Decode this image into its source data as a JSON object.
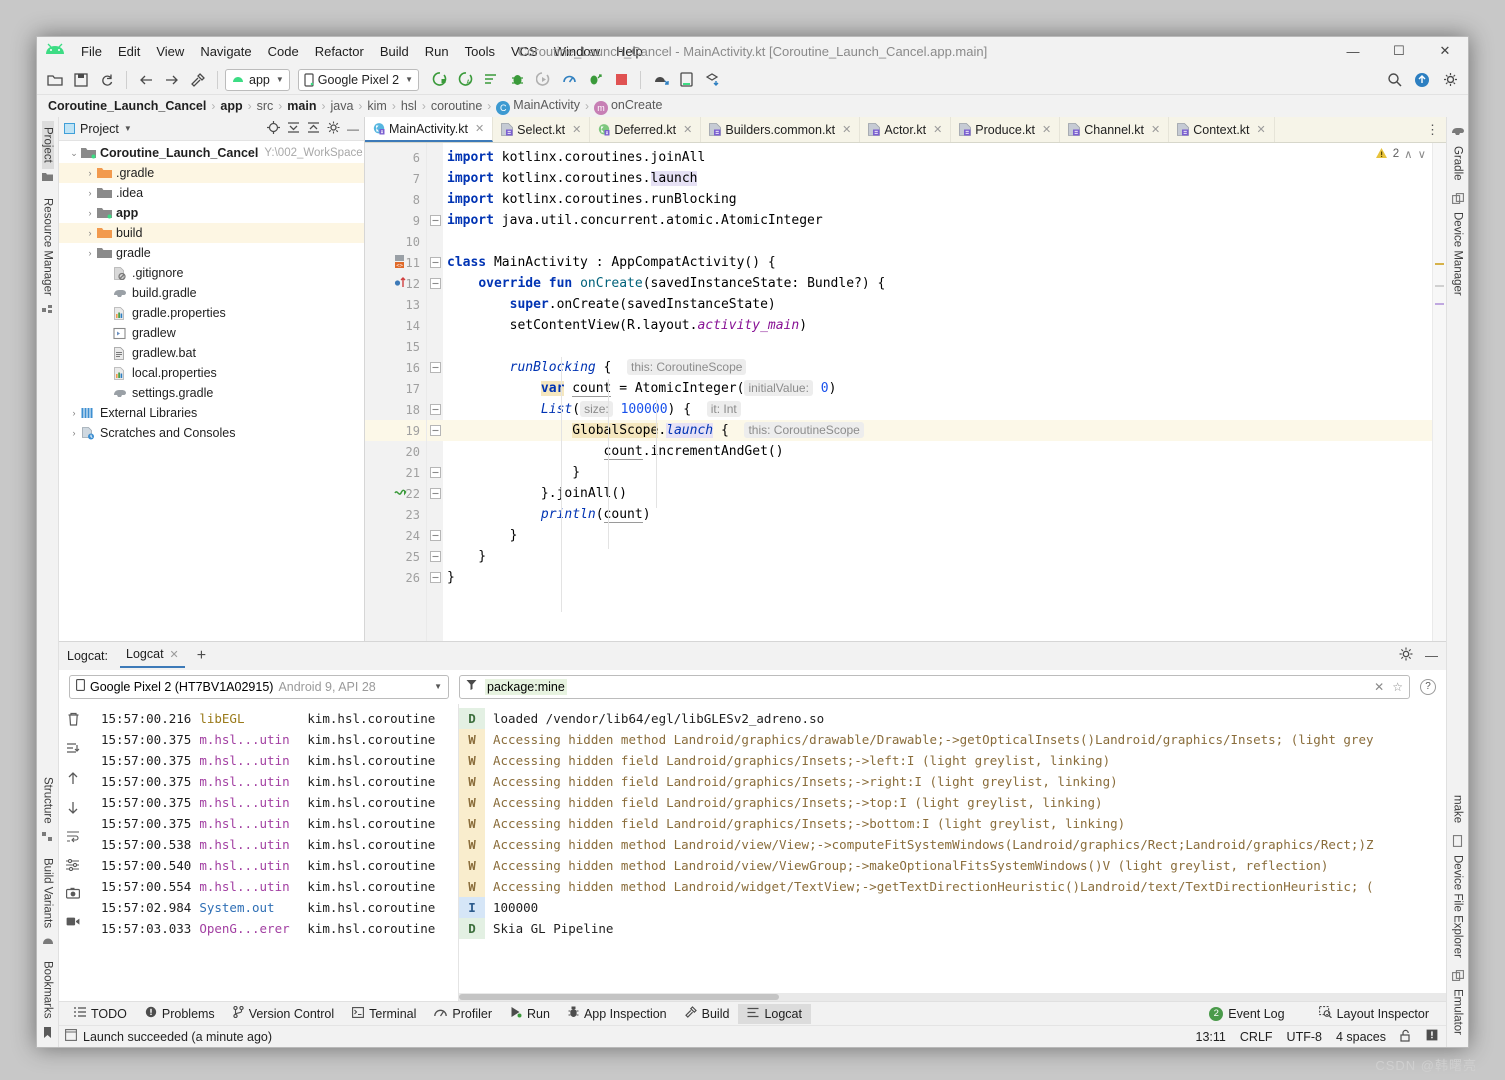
{
  "window": {
    "title": "Coroutine_Launch_Cancel - MainActivity.kt [Coroutine_Launch_Cancel.app.main]",
    "minimize": "—",
    "maximize": "☐",
    "close": "✕"
  },
  "menu": {
    "items": [
      "File",
      "Edit",
      "View",
      "Navigate",
      "Code",
      "Refactor",
      "Build",
      "Run",
      "Tools",
      "VCS",
      "Window",
      "Help"
    ]
  },
  "toolbar": {
    "module_selector": "app",
    "device_selector": "Google Pixel 2",
    "icons": [
      "open-folder-icon",
      "save-all-icon",
      "sync-icon",
      "back-arrow-icon",
      "forward-arrow-icon",
      "build-hammer-icon",
      "run-icon",
      "run-coverage-icon",
      "run-anything-icon",
      "debug-icon",
      "rerun-icon",
      "profile-icon",
      "attach-debugger-icon",
      "stop-icon",
      "avd-manager-icon",
      "sdk-manager-icon",
      "sync-gradle-icon"
    ],
    "right_icons": [
      "search-icon",
      "update-icon",
      "settings-icon"
    ]
  },
  "breadcrumb": {
    "items": [
      {
        "label": "Coroutine_Launch_Cancel",
        "bold": true,
        "icon": null
      },
      {
        "label": "app",
        "bold": true,
        "icon": null
      },
      {
        "label": "src",
        "bold": false,
        "icon": null
      },
      {
        "label": "main",
        "bold": true,
        "icon": null
      },
      {
        "label": "java",
        "bold": false,
        "icon": null
      },
      {
        "label": "kim",
        "bold": false,
        "icon": null
      },
      {
        "label": "hsl",
        "bold": false,
        "icon": null
      },
      {
        "label": "coroutine",
        "bold": false,
        "icon": null
      },
      {
        "label": "MainActivity",
        "bold": false,
        "icon": "class-icon",
        "icon_char": "C",
        "icon_color": "#3d9ad1"
      },
      {
        "label": "onCreate",
        "bold": false,
        "icon": "method-icon",
        "icon_char": "m",
        "icon_color": "#c77fb5"
      }
    ],
    "separator": "›"
  },
  "left_toolbar": {
    "top": [
      {
        "label": "Project",
        "icon": "project-icon",
        "selected": true
      },
      {
        "label": "Resource Manager",
        "icon": "resource-icon",
        "selected": false
      }
    ],
    "bottom": [
      {
        "label": "Structure",
        "icon": "structure-icon"
      },
      {
        "label": "Build Variants",
        "icon": "android-icon"
      },
      {
        "label": "Bookmarks",
        "icon": "bookmark-icon"
      }
    ]
  },
  "right_toolbar": {
    "top": [
      {
        "label": "Gradle",
        "icon": "gradle-elephant-icon"
      },
      {
        "label": "Device Manager",
        "icon": "device-manager-icon"
      }
    ],
    "bottom": [
      {
        "label": "make",
        "icon": null
      },
      {
        "label": "Device File Explorer",
        "icon": "device-file-icon"
      },
      {
        "label": "Emulator",
        "icon": "emulator-icon"
      }
    ]
  },
  "project_panel": {
    "title": "Project",
    "header_icons": [
      "locate-icon",
      "expand-all-icon",
      "collapse-all-icon",
      "gear-icon",
      "hide-icon"
    ],
    "tree": [
      {
        "depth": 0,
        "arrow": "⌄",
        "label": "Coroutine_Launch_Cancel",
        "bold": true,
        "path": "Y:\\002_WorkSpace",
        "icon": "project-folder-icon",
        "highlight": false
      },
      {
        "depth": 1,
        "arrow": "›",
        "label": ".gradle",
        "bold": false,
        "path": "",
        "icon": "orange-folder-icon",
        "highlight": true
      },
      {
        "depth": 1,
        "arrow": "›",
        "label": ".idea",
        "bold": false,
        "path": "",
        "icon": "grey-folder-icon",
        "highlight": false
      },
      {
        "depth": 1,
        "arrow": "›",
        "label": "app",
        "bold": true,
        "path": "",
        "icon": "module-folder-icon",
        "highlight": false
      },
      {
        "depth": 1,
        "arrow": "›",
        "label": "build",
        "bold": false,
        "path": "",
        "icon": "orange-folder-icon",
        "highlight": true
      },
      {
        "depth": 1,
        "arrow": "›",
        "label": "gradle",
        "bold": false,
        "path": "",
        "icon": "grey-folder-icon",
        "highlight": false
      },
      {
        "depth": 2,
        "arrow": "",
        "label": ".gitignore",
        "bold": false,
        "path": "",
        "icon": "gitignore-file-icon",
        "highlight": false
      },
      {
        "depth": 2,
        "arrow": "",
        "label": "build.gradle",
        "bold": false,
        "path": "",
        "icon": "gradle-file-icon",
        "highlight": false
      },
      {
        "depth": 2,
        "arrow": "",
        "label": "gradle.properties",
        "bold": false,
        "path": "",
        "icon": "properties-file-icon",
        "highlight": false
      },
      {
        "depth": 2,
        "arrow": "",
        "label": "gradlew",
        "bold": false,
        "path": "",
        "icon": "script-file-icon",
        "highlight": false
      },
      {
        "depth": 2,
        "arrow": "",
        "label": "gradlew.bat",
        "bold": false,
        "path": "",
        "icon": "bat-file-icon",
        "highlight": false
      },
      {
        "depth": 2,
        "arrow": "",
        "label": "local.properties",
        "bold": false,
        "path": "",
        "icon": "properties-file-icon",
        "highlight": false
      },
      {
        "depth": 2,
        "arrow": "",
        "label": "settings.gradle",
        "bold": false,
        "path": "",
        "icon": "gradle-file-icon",
        "highlight": false
      },
      {
        "depth": 0,
        "arrow": "›",
        "label": "External Libraries",
        "bold": false,
        "path": "",
        "icon": "libraries-icon",
        "highlight": false
      },
      {
        "depth": 0,
        "arrow": "›",
        "label": "Scratches and Consoles",
        "bold": false,
        "path": "",
        "icon": "scratches-icon",
        "highlight": false
      }
    ]
  },
  "editor": {
    "tabs": [
      {
        "label": "MainActivity.kt",
        "active": true,
        "icon": "kotlin-class-icon"
      },
      {
        "label": "Select.kt",
        "active": false,
        "icon": "kotlin-file-icon"
      },
      {
        "label": "Deferred.kt",
        "active": false,
        "icon": "kotlin-interface-icon"
      },
      {
        "label": "Builders.common.kt",
        "active": false,
        "icon": "kotlin-file-icon"
      },
      {
        "label": "Actor.kt",
        "active": false,
        "icon": "kotlin-file-icon"
      },
      {
        "label": "Produce.kt",
        "active": false,
        "icon": "kotlin-file-icon"
      },
      {
        "label": "Channel.kt",
        "active": false,
        "icon": "kotlin-file-icon"
      },
      {
        "label": "Context.kt",
        "active": false,
        "icon": "kotlin-file-icon"
      }
    ],
    "inspection": {
      "warning_count": "2",
      "up": "∧",
      "down": "∨"
    },
    "first_line_number": 6,
    "lines": [
      {
        "n": 6,
        "mark": "",
        "fold": "",
        "hl": false
      },
      {
        "n": 7,
        "mark": "",
        "fold": "",
        "hl": false
      },
      {
        "n": 8,
        "mark": "",
        "fold": "",
        "hl": false
      },
      {
        "n": 9,
        "mark": "",
        "fold": "─",
        "hl": false
      },
      {
        "n": 10,
        "mark": "",
        "fold": "",
        "hl": false
      },
      {
        "n": 11,
        "mark": "class-run-icon",
        "fold": "─",
        "hl": false
      },
      {
        "n": 12,
        "mark": "override-icon",
        "fold": "─",
        "hl": false
      },
      {
        "n": 13,
        "mark": "",
        "fold": "",
        "hl": false
      },
      {
        "n": 14,
        "mark": "",
        "fold": "",
        "hl": false
      },
      {
        "n": 15,
        "mark": "",
        "fold": "",
        "hl": false
      },
      {
        "n": 16,
        "mark": "",
        "fold": "─",
        "hl": false
      },
      {
        "n": 17,
        "mark": "",
        "fold": "",
        "hl": false
      },
      {
        "n": 18,
        "mark": "",
        "fold": "─",
        "hl": false
      },
      {
        "n": 19,
        "mark": "",
        "fold": "─",
        "hl": true
      },
      {
        "n": 20,
        "mark": "",
        "fold": "",
        "hl": false
      },
      {
        "n": 21,
        "mark": "",
        "fold": "└",
        "hl": false
      },
      {
        "n": 22,
        "mark": "suspend-icon",
        "fold": "└",
        "hl": false
      },
      {
        "n": 23,
        "mark": "",
        "fold": "",
        "hl": false
      },
      {
        "n": 24,
        "mark": "",
        "fold": "└",
        "hl": false
      },
      {
        "n": 25,
        "mark": "",
        "fold": "└",
        "hl": false
      },
      {
        "n": 26,
        "mark": "",
        "fold": "└",
        "hl": false
      }
    ],
    "code_text": [
      "import kotlinx.coroutines.joinAll",
      "import kotlinx.coroutines.launch",
      "import kotlinx.coroutines.runBlocking",
      "import java.util.concurrent.atomic.AtomicInteger",
      "",
      "class MainActivity : AppCompatActivity() {",
      "    override fun onCreate(savedInstanceState: Bundle?) {",
      "        super.onCreate(savedInstanceState)",
      "        setContentView(R.layout.activity_main)",
      "",
      "        runBlocking {  this: CoroutineScope",
      "            var count = AtomicInteger( initialValue: 0)",
      "            List( size: 100000) {  it: Int",
      "                GlobalScope.launch {  this: CoroutineScope",
      "                    count.incrementAndGet()",
      "                }",
      "            }.joinAll()",
      "            println(count)",
      "        }",
      "    }",
      "}"
    ]
  },
  "logcat": {
    "panel_label": "Logcat:",
    "tab_label": "Logcat",
    "tab_close": "✕",
    "add_tab": "+",
    "header_right_icons": [
      "gear-icon",
      "hide-icon"
    ],
    "device": {
      "name": "Google Pixel 2 (HT7BV1A02915)",
      "info": "Android 9, API 28",
      "icon": "phone-icon"
    },
    "filter": {
      "value": "package:mine",
      "clear": "✕",
      "favorite": "☆",
      "help": "?"
    },
    "side_icons": [
      "trash-icon",
      "scroll-to-end-icon",
      "up-arrow-icon",
      "down-arrow-icon",
      "soft-wrap-icon",
      "filter-settings-icon",
      "screenshot-icon",
      "screen-record-icon"
    ],
    "rows": [
      {
        "time": "15:57:00.216",
        "tag": "libEGL",
        "tag_color": "#9a7a1a",
        "package": "kim.hsl.coroutine",
        "level": "D",
        "message": "loaded /vendor/lib64/egl/libGLESv2_adreno.so"
      },
      {
        "time": "15:57:00.375",
        "tag": "m.hsl...utin",
        "tag_color": "#a23fa2",
        "package": "kim.hsl.coroutine",
        "level": "W",
        "message": "Accessing hidden method Landroid/graphics/drawable/Drawable;->getOpticalInsets()Landroid/graphics/Insets; (light grey"
      },
      {
        "time": "15:57:00.375",
        "tag": "m.hsl...utin",
        "tag_color": "#a23fa2",
        "package": "kim.hsl.coroutine",
        "level": "W",
        "message": "Accessing hidden field Landroid/graphics/Insets;->left:I (light greylist, linking)"
      },
      {
        "time": "15:57:00.375",
        "tag": "m.hsl...utin",
        "tag_color": "#a23fa2",
        "package": "kim.hsl.coroutine",
        "level": "W",
        "message": "Accessing hidden field Landroid/graphics/Insets;->right:I (light greylist, linking)"
      },
      {
        "time": "15:57:00.375",
        "tag": "m.hsl...utin",
        "tag_color": "#a23fa2",
        "package": "kim.hsl.coroutine",
        "level": "W",
        "message": "Accessing hidden field Landroid/graphics/Insets;->top:I (light greylist, linking)"
      },
      {
        "time": "15:57:00.375",
        "tag": "m.hsl...utin",
        "tag_color": "#a23fa2",
        "package": "kim.hsl.coroutine",
        "level": "W",
        "message": "Accessing hidden field Landroid/graphics/Insets;->bottom:I (light greylist, linking)"
      },
      {
        "time": "15:57:00.538",
        "tag": "m.hsl...utin",
        "tag_color": "#a23fa2",
        "package": "kim.hsl.coroutine",
        "level": "W",
        "message": "Accessing hidden method Landroid/view/View;->computeFitSystemWindows(Landroid/graphics/Rect;Landroid/graphics/Rect;)Z"
      },
      {
        "time": "15:57:00.540",
        "tag": "m.hsl...utin",
        "tag_color": "#a23fa2",
        "package": "kim.hsl.coroutine",
        "level": "W",
        "message": "Accessing hidden method Landroid/view/ViewGroup;->makeOptionalFitsSystemWindows()V (light greylist, reflection)"
      },
      {
        "time": "15:57:00.554",
        "tag": "m.hsl...utin",
        "tag_color": "#a23fa2",
        "package": "kim.hsl.coroutine",
        "level": "W",
        "message": "Accessing hidden method Landroid/widget/TextView;->getTextDirectionHeuristic()Landroid/text/TextDirectionHeuristic; ("
      },
      {
        "time": "15:57:02.984",
        "tag": "System.out",
        "tag_color": "#2f6fb5",
        "package": "kim.hsl.coroutine",
        "level": "I",
        "message": "100000"
      },
      {
        "time": "15:57:03.033",
        "tag": "OpenG...erer",
        "tag_color": "#a23fa2",
        "package": "kim.hsl.coroutine",
        "level": "D",
        "message": "Skia GL Pipeline"
      }
    ]
  },
  "tool_windows": {
    "left_items": [
      {
        "label": "TODO",
        "icon": "todo-icon",
        "active": false
      },
      {
        "label": "Problems",
        "icon": "problems-icon",
        "active": false
      },
      {
        "label": "Version Control",
        "icon": "vcs-icon",
        "active": false
      },
      {
        "label": "Terminal",
        "icon": "terminal-icon",
        "active": false
      },
      {
        "label": "Profiler",
        "icon": "profiler-icon",
        "active": false
      },
      {
        "label": "Run",
        "icon": "run-icon",
        "active": false
      },
      {
        "label": "App Inspection",
        "icon": "app-inspection-icon",
        "active": false
      },
      {
        "label": "Build",
        "icon": "build-hammer-icon",
        "active": false
      },
      {
        "label": "Logcat",
        "icon": "logcat-icon",
        "active": true
      }
    ],
    "right_items": [
      {
        "label": "Event Log",
        "icon": "event-log-icon",
        "badge": "2"
      },
      {
        "label": "Layout Inspector",
        "icon": "layout-inspector-icon",
        "badge": ""
      }
    ]
  },
  "status_bar": {
    "message": "Launch succeeded (a minute ago)",
    "message_icon": "console-icon",
    "caret_position": "13:11",
    "line_separator": "CRLF",
    "encoding": "UTF-8",
    "indent": "4 spaces",
    "lock_icon": "unlocked-icon",
    "notify_icon": "notification-icon"
  },
  "watermark": "CSDN @韩曙亮"
}
